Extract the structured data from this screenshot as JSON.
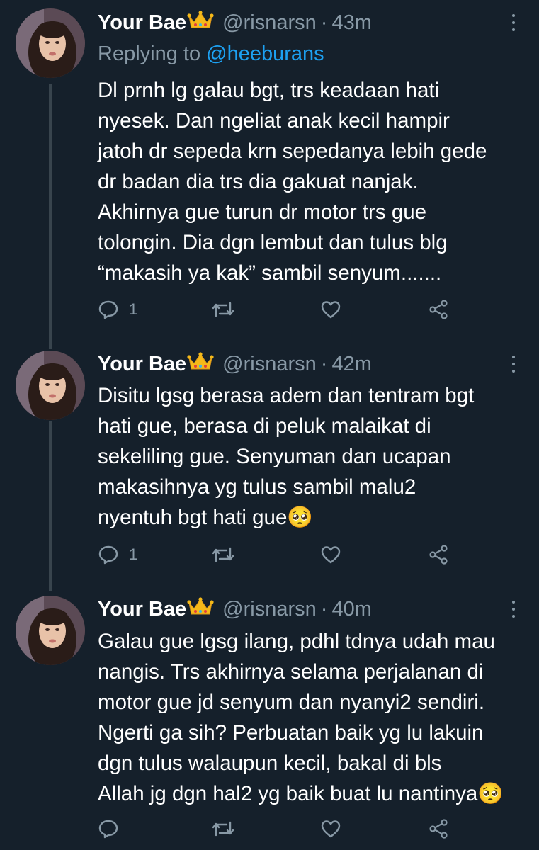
{
  "colors": {
    "background": "#15202b",
    "secondary_text": "#8899a6",
    "mention": "#1da1f2",
    "thread_line": "#38444d",
    "crown": "#f5b919"
  },
  "thread": [
    {
      "display_name": "Your Bae",
      "handle": "@risnarsn",
      "dot": "·",
      "time": "43m",
      "reply_prefix": "Replying to",
      "reply_to": "@heeburans",
      "text": "Dl prnh lg galau bgt, trs keadaan hati\nnyesek. Dan ngeliat anak kecil hampir\njatoh dr sepeda krn sepedanya lebih gede\ndr badan dia trs dia gakuat nanjak.\nAkhirnya gue turun dr motor trs gue\ntolongin. Dia dgn lembut dan tulus blg\n“makasih ya kak” sambil senyum.......",
      "reply_count": "1",
      "icons": [
        "crown-emoji",
        "reply-icon",
        "retweet-icon",
        "like-icon",
        "share-icon",
        "more-icon"
      ]
    },
    {
      "display_name": "Your Bae",
      "handle": "@risnarsn",
      "dot": "·",
      "time": "42m",
      "text": "Disitu lgsg berasa adem dan tentram bgt\nhati gue, berasa di peluk malaikat di\nsekeliling gue. Senyuman dan ucapan\nmakasihnya yg tulus sambil malu2\nnyentuh bgt hati gue🥺",
      "reply_count": "1"
    },
    {
      "display_name": "Your Bae",
      "handle": "@risnarsn",
      "dot": "·",
      "time": "40m",
      "text": "Galau gue lgsg ilang, pdhl tdnya udah mau\nnangis. Trs akhirnya selama perjalanan di\nmotor gue jd senyum dan nyanyi2 sendiri.\nNgerti ga sih? Perbuatan baik yg lu lakuin\ndgn tulus walaupun kecil, bakal di bls\nAllah jg dgn hal2 yg baik buat lu nantinya🥺",
      "reply_count": ""
    }
  ]
}
